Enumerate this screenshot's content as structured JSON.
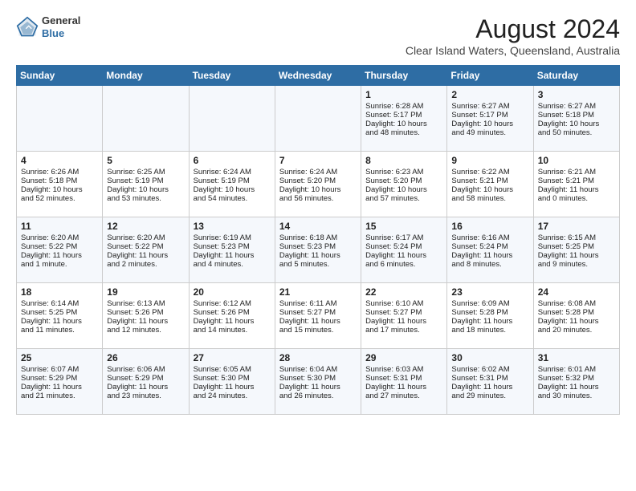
{
  "header": {
    "logo_general": "General",
    "logo_blue": "Blue",
    "title": "August 2024",
    "subtitle": "Clear Island Waters, Queensland, Australia"
  },
  "days_of_week": [
    "Sunday",
    "Monday",
    "Tuesday",
    "Wednesday",
    "Thursday",
    "Friday",
    "Saturday"
  ],
  "weeks": [
    [
      {
        "day": "",
        "info": ""
      },
      {
        "day": "",
        "info": ""
      },
      {
        "day": "",
        "info": ""
      },
      {
        "day": "",
        "info": ""
      },
      {
        "day": "1",
        "info": "Sunrise: 6:28 AM\nSunset: 5:17 PM\nDaylight: 10 hours\nand 48 minutes."
      },
      {
        "day": "2",
        "info": "Sunrise: 6:27 AM\nSunset: 5:17 PM\nDaylight: 10 hours\nand 49 minutes."
      },
      {
        "day": "3",
        "info": "Sunrise: 6:27 AM\nSunset: 5:18 PM\nDaylight: 10 hours\nand 50 minutes."
      }
    ],
    [
      {
        "day": "4",
        "info": "Sunrise: 6:26 AM\nSunset: 5:18 PM\nDaylight: 10 hours\nand 52 minutes."
      },
      {
        "day": "5",
        "info": "Sunrise: 6:25 AM\nSunset: 5:19 PM\nDaylight: 10 hours\nand 53 minutes."
      },
      {
        "day": "6",
        "info": "Sunrise: 6:24 AM\nSunset: 5:19 PM\nDaylight: 10 hours\nand 54 minutes."
      },
      {
        "day": "7",
        "info": "Sunrise: 6:24 AM\nSunset: 5:20 PM\nDaylight: 10 hours\nand 56 minutes."
      },
      {
        "day": "8",
        "info": "Sunrise: 6:23 AM\nSunset: 5:20 PM\nDaylight: 10 hours\nand 57 minutes."
      },
      {
        "day": "9",
        "info": "Sunrise: 6:22 AM\nSunset: 5:21 PM\nDaylight: 10 hours\nand 58 minutes."
      },
      {
        "day": "10",
        "info": "Sunrise: 6:21 AM\nSunset: 5:21 PM\nDaylight: 11 hours\nand 0 minutes."
      }
    ],
    [
      {
        "day": "11",
        "info": "Sunrise: 6:20 AM\nSunset: 5:22 PM\nDaylight: 11 hours\nand 1 minute."
      },
      {
        "day": "12",
        "info": "Sunrise: 6:20 AM\nSunset: 5:22 PM\nDaylight: 11 hours\nand 2 minutes."
      },
      {
        "day": "13",
        "info": "Sunrise: 6:19 AM\nSunset: 5:23 PM\nDaylight: 11 hours\nand 4 minutes."
      },
      {
        "day": "14",
        "info": "Sunrise: 6:18 AM\nSunset: 5:23 PM\nDaylight: 11 hours\nand 5 minutes."
      },
      {
        "day": "15",
        "info": "Sunrise: 6:17 AM\nSunset: 5:24 PM\nDaylight: 11 hours\nand 6 minutes."
      },
      {
        "day": "16",
        "info": "Sunrise: 6:16 AM\nSunset: 5:24 PM\nDaylight: 11 hours\nand 8 minutes."
      },
      {
        "day": "17",
        "info": "Sunrise: 6:15 AM\nSunset: 5:25 PM\nDaylight: 11 hours\nand 9 minutes."
      }
    ],
    [
      {
        "day": "18",
        "info": "Sunrise: 6:14 AM\nSunset: 5:25 PM\nDaylight: 11 hours\nand 11 minutes."
      },
      {
        "day": "19",
        "info": "Sunrise: 6:13 AM\nSunset: 5:26 PM\nDaylight: 11 hours\nand 12 minutes."
      },
      {
        "day": "20",
        "info": "Sunrise: 6:12 AM\nSunset: 5:26 PM\nDaylight: 11 hours\nand 14 minutes."
      },
      {
        "day": "21",
        "info": "Sunrise: 6:11 AM\nSunset: 5:27 PM\nDaylight: 11 hours\nand 15 minutes."
      },
      {
        "day": "22",
        "info": "Sunrise: 6:10 AM\nSunset: 5:27 PM\nDaylight: 11 hours\nand 17 minutes."
      },
      {
        "day": "23",
        "info": "Sunrise: 6:09 AM\nSunset: 5:28 PM\nDaylight: 11 hours\nand 18 minutes."
      },
      {
        "day": "24",
        "info": "Sunrise: 6:08 AM\nSunset: 5:28 PM\nDaylight: 11 hours\nand 20 minutes."
      }
    ],
    [
      {
        "day": "25",
        "info": "Sunrise: 6:07 AM\nSunset: 5:29 PM\nDaylight: 11 hours\nand 21 minutes."
      },
      {
        "day": "26",
        "info": "Sunrise: 6:06 AM\nSunset: 5:29 PM\nDaylight: 11 hours\nand 23 minutes."
      },
      {
        "day": "27",
        "info": "Sunrise: 6:05 AM\nSunset: 5:30 PM\nDaylight: 11 hours\nand 24 minutes."
      },
      {
        "day": "28",
        "info": "Sunrise: 6:04 AM\nSunset: 5:30 PM\nDaylight: 11 hours\nand 26 minutes."
      },
      {
        "day": "29",
        "info": "Sunrise: 6:03 AM\nSunset: 5:31 PM\nDaylight: 11 hours\nand 27 minutes."
      },
      {
        "day": "30",
        "info": "Sunrise: 6:02 AM\nSunset: 5:31 PM\nDaylight: 11 hours\nand 29 minutes."
      },
      {
        "day": "31",
        "info": "Sunrise: 6:01 AM\nSunset: 5:32 PM\nDaylight: 11 hours\nand 30 minutes."
      }
    ]
  ]
}
